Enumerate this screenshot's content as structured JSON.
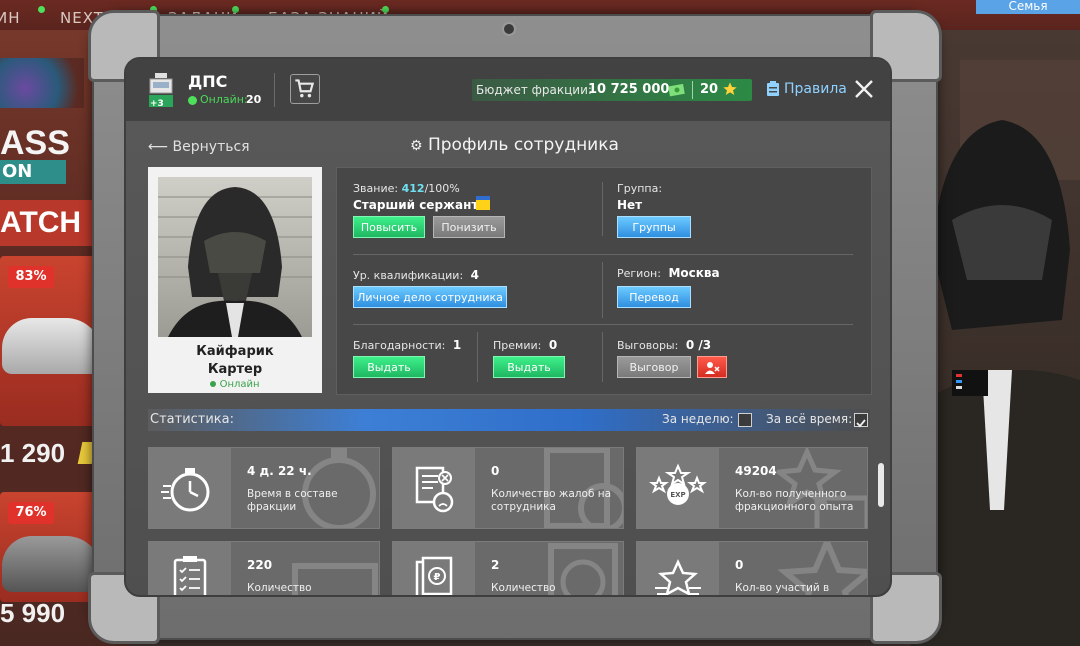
{
  "background": {
    "topnav": [
      {
        "label": "ИН"
      },
      {
        "label": "NEXTR"
      },
      {
        "label": "ЗАДАНИ"
      },
      {
        "label": "БАЗА ЗНАНИЙ"
      }
    ],
    "family_button": "Семья",
    "pass_text": "ASS",
    "pass_on": "ON",
    "match_text": "ATCH",
    "cards": [
      {
        "discount": "83%",
        "price": "1 290"
      },
      {
        "discount": "76%",
        "price": "5 990"
      }
    ]
  },
  "header": {
    "faction_name": "ДПС",
    "badge": "+3",
    "online_label": "Онлайн:",
    "online_count": "20",
    "budget_label": "Бюджет фракции:",
    "budget_value": "10 725 000",
    "stars": "20",
    "rules": "Правила"
  },
  "nav": {
    "back": "Вернуться",
    "title": "Профиль сотрудника"
  },
  "employee": {
    "first_name": "Кайфарик",
    "last_name": "Картер",
    "status": "Онлайн"
  },
  "info": {
    "rank_label": "Звание:",
    "rank_progress": "412",
    "rank_progress_max": "/100%",
    "rank_name": "Старший сержант",
    "promote": "Повысить",
    "demote": "Понизить",
    "group_label": "Группа:",
    "group_value": "Нет",
    "groups_button": "Группы",
    "qual_label": "Ур. квалификации:",
    "qual_value": "4",
    "dossier_button": "Личное дело сотрудника",
    "region_label": "Регион:",
    "region_value": "Москва",
    "transfer_button": "Перевод",
    "thanks_label": "Благодарности:",
    "thanks_value": "1",
    "thanks_button": "Выдать",
    "bonus_label": "Премии:",
    "bonus_value": "0",
    "bonus_button": "Выдать",
    "reprimand_label": "Выговоры:",
    "reprimand_value": "0 /3",
    "reprimand_button": "Выговор"
  },
  "stats": {
    "label": "Статистика:",
    "week_label": "За неделю:",
    "week_checked": false,
    "all_label": "За всё время:",
    "all_checked": true,
    "cards": [
      {
        "value": "4 д. 22 ч.",
        "label": "Время в составе фракции",
        "icon": "stopwatch-icon"
      },
      {
        "value": "0",
        "label": "Количество жалоб на сотрудника",
        "icon": "complaint-icon"
      },
      {
        "value": "49204",
        "label": "Кол-во полученного фракционного опыта",
        "icon": "exp-stars-icon"
      },
      {
        "value": "220",
        "label": "Количество",
        "icon": "checklist-icon"
      },
      {
        "value": "2",
        "label": "Количество",
        "icon": "ruble-document-icon"
      },
      {
        "value": "0",
        "label": "Кол-во участий в",
        "icon": "star-rank-icon"
      }
    ]
  },
  "colors": {
    "accent_green": "#1fb762",
    "accent_blue": "#2f8fe0",
    "accent_red": "#d62c22",
    "online_green": "#4ee05a",
    "rules_blue": "#8fd2ff"
  }
}
